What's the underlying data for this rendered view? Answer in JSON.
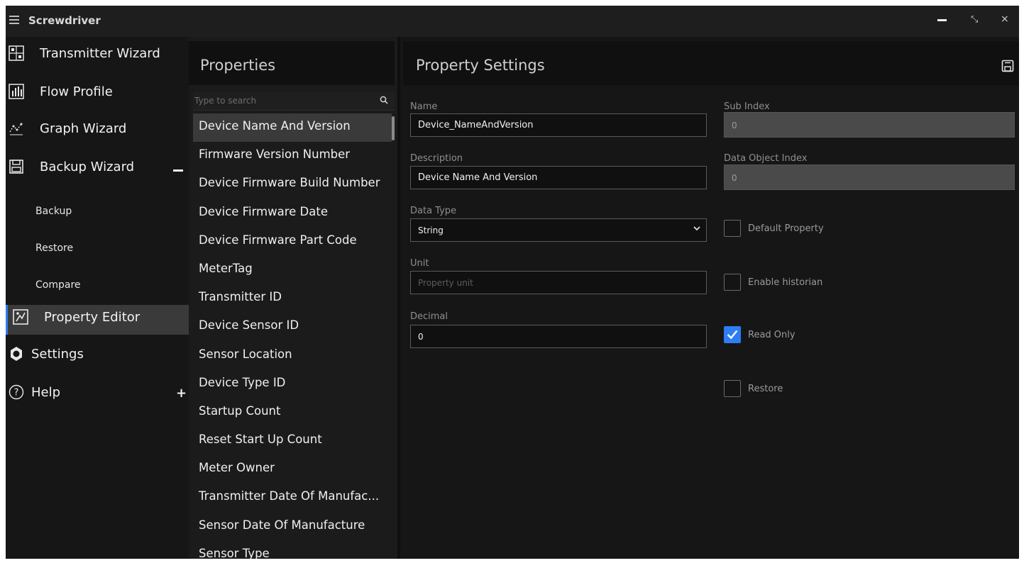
{
  "app": {
    "title": "Screwdriver"
  },
  "window_controls": {
    "maximize_glyph": "⤡",
    "close_glyph": "×"
  },
  "sidebar": {
    "items": [
      {
        "label": "Transmitter Wizard",
        "icon": "transmitter-icon"
      },
      {
        "label": "Flow Profile",
        "icon": "flow-profile-icon"
      },
      {
        "label": "Graph Wizard",
        "icon": "graph-icon"
      },
      {
        "label": "Backup Wizard",
        "icon": "floppy-icon"
      },
      {
        "label": "Property Editor",
        "icon": "property-editor-icon"
      },
      {
        "label": "Settings",
        "icon": "gear-icon"
      },
      {
        "label": "Help",
        "icon": "help-icon"
      }
    ],
    "backup_subitems": [
      "Backup",
      "Restore",
      "Compare"
    ],
    "active_item": "Property Editor"
  },
  "properties": {
    "title": "Properties",
    "search_placeholder": "Type to search",
    "items": [
      "Device Name And Version",
      "Firmware Version Number",
      "Device Firmware Build Number",
      "Device Firmware Date",
      "Device Firmware Part Code",
      "MeterTag",
      "Transmitter ID",
      "Device Sensor ID",
      "Sensor Location",
      "Device Type ID",
      "Startup Count",
      "Reset Start Up Count",
      "Meter Owner",
      "Transmitter Date Of Manufac...",
      "Sensor Date Of Manufacture",
      "Sensor Type"
    ],
    "selected_index": 0
  },
  "settings": {
    "title": "Property Settings",
    "name": {
      "label": "Name",
      "value": "Device_NameAndVersion"
    },
    "description": {
      "label": "Description",
      "value": "Device Name And Version"
    },
    "data_type": {
      "label": "Data Type",
      "value": "String"
    },
    "unit": {
      "label": "Unit",
      "placeholder": "Property unit"
    },
    "decimal": {
      "label": "Decimal",
      "value": "0"
    },
    "sub_index": {
      "label": "Sub Index",
      "value": "0"
    },
    "data_object_index": {
      "label": "Data Object Index",
      "value": "0"
    },
    "checkboxes": {
      "default_property": {
        "label": "Default Property",
        "checked": false
      },
      "enable_historian": {
        "label": "Enable historian",
        "checked": false
      },
      "read_only": {
        "label": "Read Only",
        "checked": true
      },
      "restore": {
        "label": "Restore",
        "checked": false
      }
    }
  },
  "colors": {
    "accent": "#2e7df6",
    "background": "#161616",
    "selected": "#3a3a3a"
  }
}
